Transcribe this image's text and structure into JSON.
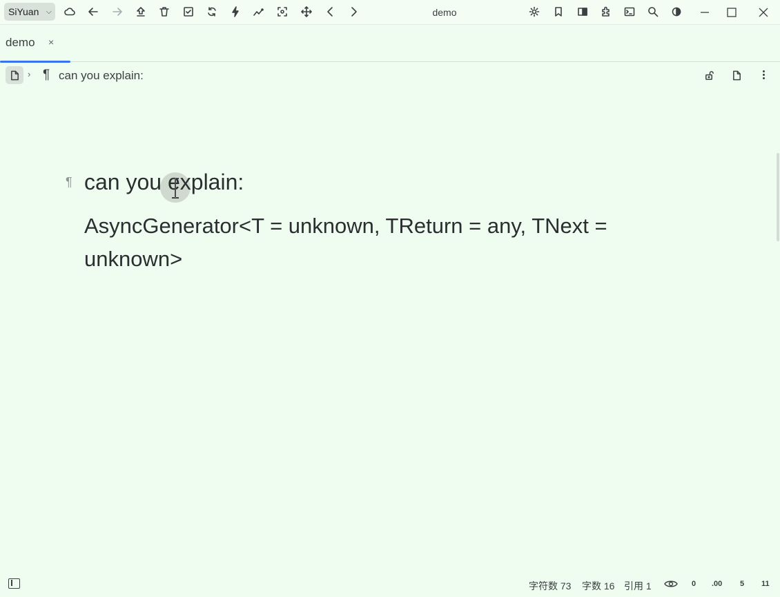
{
  "app": {
    "brand": "SiYuan",
    "window_title": "demo"
  },
  "toolbar": {
    "icons": [
      "cloud-icon",
      "back-icon",
      "forward-icon",
      "upload-icon",
      "trash-icon",
      "checkbox-icon",
      "sync-icon",
      "flash-icon",
      "graph-icon",
      "focus-icon",
      "move-icon",
      "chevron-left-icon",
      "chevron-right-icon"
    ],
    "right_icons": [
      "settings-icon",
      "bookmark-icon",
      "book-icon",
      "plugin-icon",
      "terminal-icon",
      "search-icon",
      "contrast-icon"
    ]
  },
  "tabs": [
    {
      "label": "demo",
      "close": "×",
      "active": true
    }
  ],
  "breadcrumb": {
    "separator": "›",
    "para_glyph": "¶",
    "text": "can you explain:"
  },
  "document": {
    "para_mark": "¶",
    "heading": "can you explain:",
    "lines": [
      "AsyncGenerator<T = unknown, TReturn = any, TNext =",
      "unknown>"
    ]
  },
  "status": {
    "chars": "字符数 73",
    "words": "字数 16",
    "refs": "引用 1",
    "small": [
      "0",
      ".00",
      "5",
      "11"
    ]
  },
  "colors": {
    "background": "#eefdf0",
    "accent": "#3573f0",
    "text": "#2b2e31"
  }
}
